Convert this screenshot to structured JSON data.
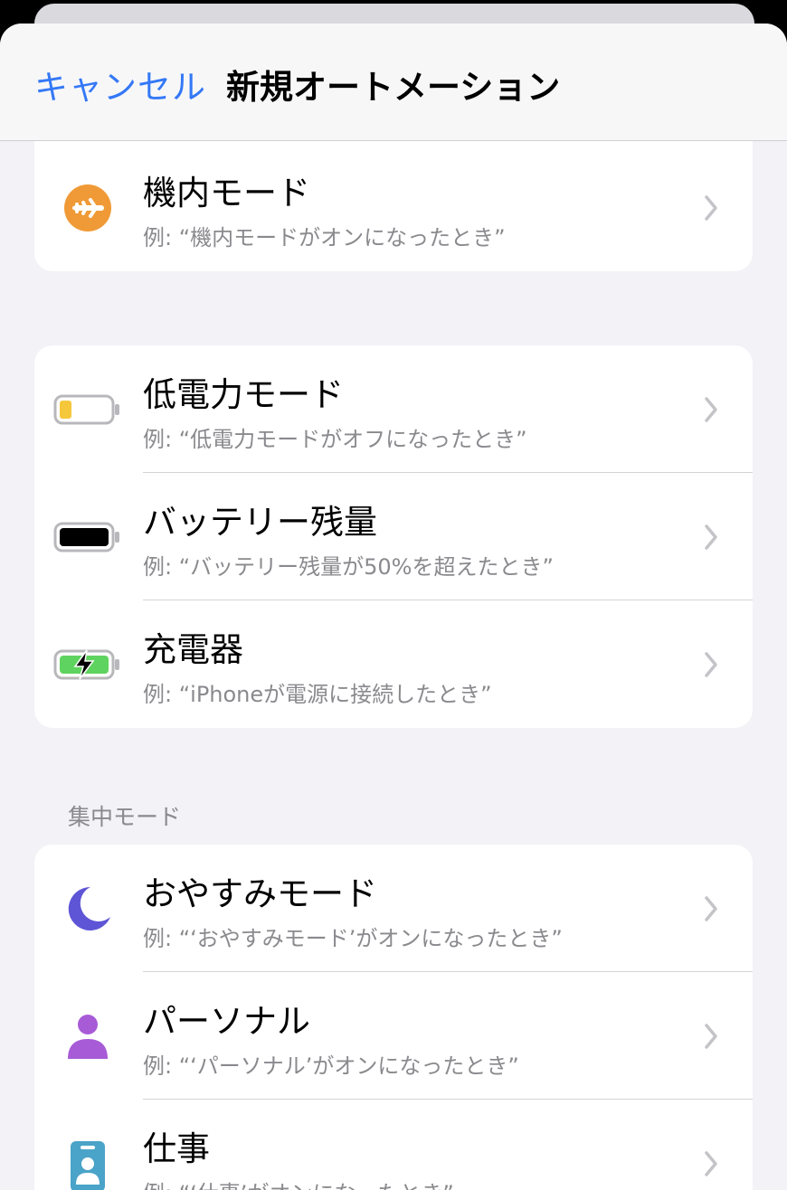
{
  "navbar": {
    "cancel_label": "キャンセル",
    "title": "新規オートメーション"
  },
  "group1": {
    "items": [
      {
        "title": "機内モード",
        "subtitle": "例: “機内モードがオンになったとき”",
        "icon": "airplane-icon"
      }
    ]
  },
  "group2": {
    "items": [
      {
        "title": "低電力モード",
        "subtitle": "例: “低電力モードがオフになったとき”",
        "icon": "low-battery-icon"
      },
      {
        "title": "バッテリー残量",
        "subtitle": "例: “バッテリー残量が50%を超えたとき”",
        "icon": "battery-icon"
      },
      {
        "title": "充電器",
        "subtitle": "例: “iPhoneが電源に接続したとき”",
        "icon": "charging-battery-icon"
      }
    ]
  },
  "focus_section": {
    "header": "集中モード",
    "items": [
      {
        "title": "おやすみモード",
        "subtitle": "例: “‘おやすみモード’がオンになったとき”",
        "icon": "moon-icon"
      },
      {
        "title": "パーソナル",
        "subtitle": "例: “‘パーソナル’がオンになったとき”",
        "icon": "person-icon"
      },
      {
        "title": "仕事",
        "subtitle": "例: “‘仕事’がオンになったとき”",
        "icon": "work-badge-icon"
      }
    ]
  },
  "colors": {
    "accent": "#3478f6",
    "airplane": "#f09a37",
    "low_power": "#f5c73a",
    "charging": "#5fd35f",
    "sleep": "#5e55d6",
    "personal": "#a85bd6",
    "work": "#4aa3c8"
  }
}
